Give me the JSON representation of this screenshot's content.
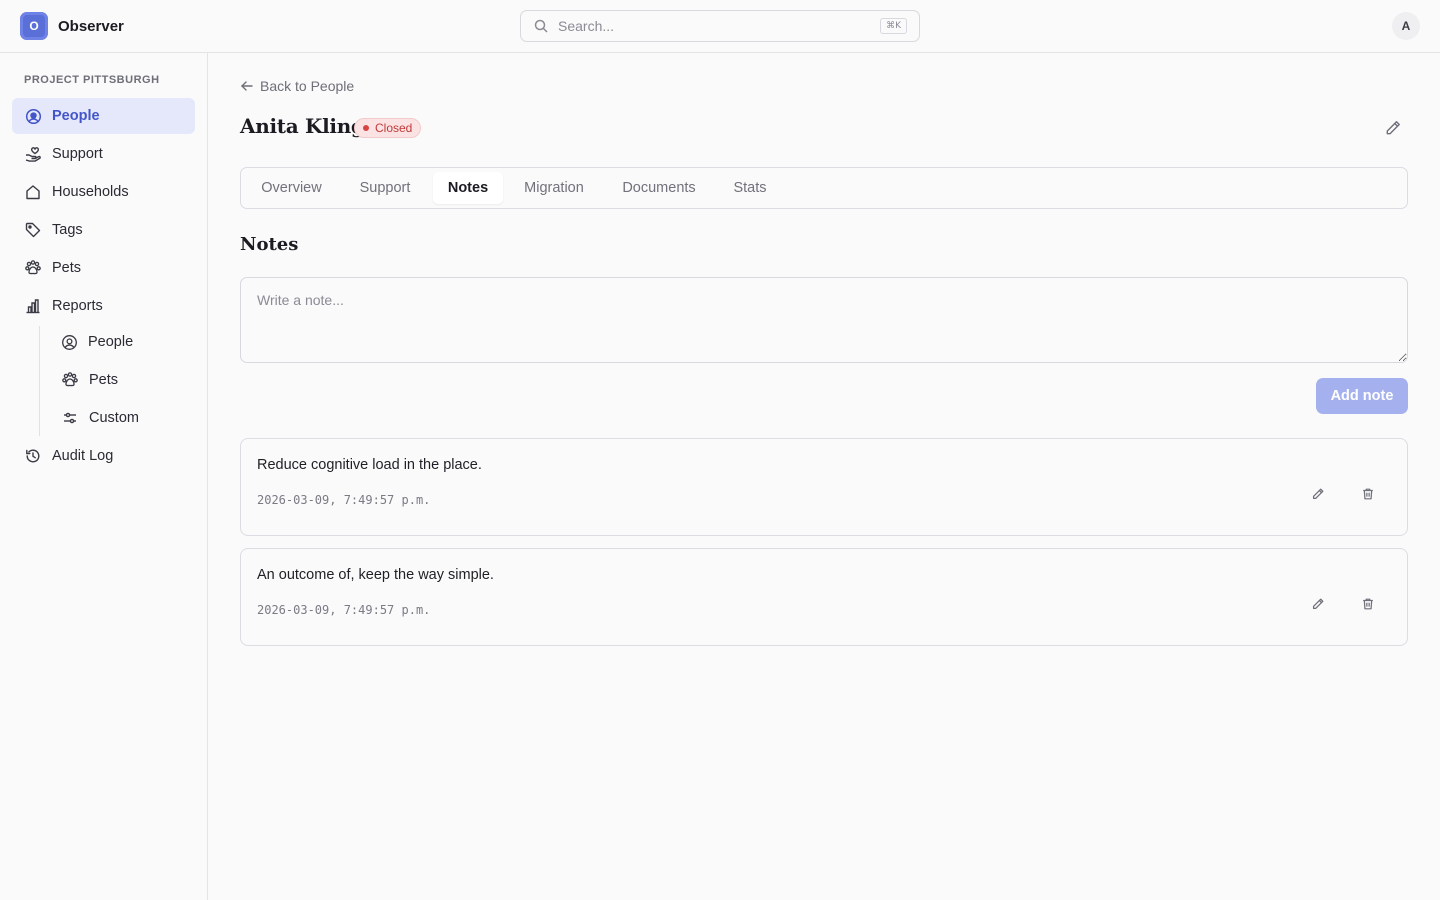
{
  "app": {
    "logo_letter": "O",
    "name": "Observer"
  },
  "search": {
    "placeholder": "Search...",
    "shortcut": "⌘K"
  },
  "user": {
    "avatar_initial": "A"
  },
  "sidebar": {
    "project_label": "PROJECT PITTSBURGH",
    "items": [
      {
        "label": "People",
        "icon": "user-circle-icon",
        "active": true
      },
      {
        "label": "Support",
        "icon": "hand-heart-icon"
      },
      {
        "label": "Households",
        "icon": "house-icon"
      },
      {
        "label": "Tags",
        "icon": "tag-icon"
      },
      {
        "label": "Pets",
        "icon": "paw-icon"
      },
      {
        "label": "Reports",
        "icon": "bar-chart-icon"
      }
    ],
    "report_items": [
      {
        "label": "People",
        "icon": "user-circle-icon"
      },
      {
        "label": "Pets",
        "icon": "paw-icon"
      },
      {
        "label": "Custom",
        "icon": "sliders-icon"
      }
    ],
    "audit": {
      "label": "Audit Log",
      "icon": "history-icon"
    }
  },
  "page": {
    "back_label": "Back to People",
    "person_name": "Anita Kling",
    "status": "Closed",
    "status_color": "#c03a3a"
  },
  "tabs": [
    {
      "label": "Overview"
    },
    {
      "label": "Support"
    },
    {
      "label": "Notes",
      "active": true
    },
    {
      "label": "Migration"
    },
    {
      "label": "Documents"
    },
    {
      "label": "Stats"
    }
  ],
  "notes": {
    "title": "Notes",
    "input_placeholder": "Write a note...",
    "add_label": "Add note",
    "add_color": "#a5b1ee",
    "items": [
      {
        "text": "Reduce cognitive load in the place.",
        "timestamp": "2026-03-09, 7:49:57 p.m."
      },
      {
        "text": "An outcome of, keep the way simple.",
        "timestamp": "2026-03-09, 7:49:57 p.m."
      }
    ]
  },
  "colors": {
    "accent": "#5b6fd8",
    "active_bg": "#e5e8fa",
    "active_text": "#4455c9"
  }
}
